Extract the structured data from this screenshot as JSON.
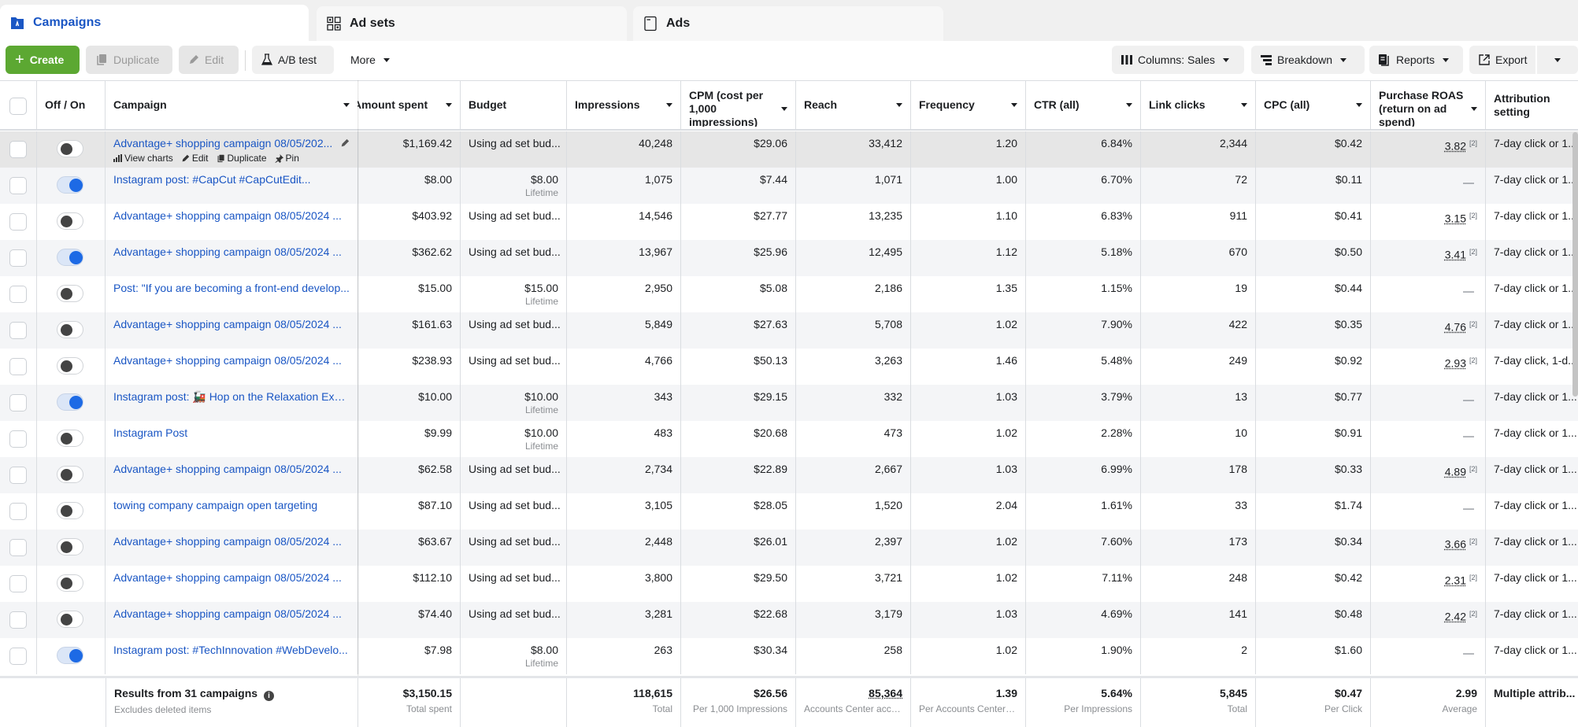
{
  "tabs": [
    {
      "label": "Campaigns",
      "icon": "campaigns-icon",
      "active": true
    },
    {
      "label": "Ad sets",
      "icon": "ad-sets-grid-icon",
      "active": false
    },
    {
      "label": "Ads",
      "icon": "ads-page-icon",
      "active": false
    }
  ],
  "toolbar": {
    "create_label": "Create",
    "duplicate_label": "Duplicate",
    "edit_label": "Edit",
    "ab_test_label": "A/B test",
    "more_label": "More",
    "columns_label": "Columns: Sales",
    "breakdown_label": "Breakdown",
    "reports_label": "Reports",
    "export_label": "Export"
  },
  "columns": {
    "off_on": "Off / On",
    "campaign": "Campaign",
    "amount_spent": "Amount spent",
    "budget": "Budget",
    "impressions": "Impressions",
    "cpm": "CPM (cost per 1,000 impressions)",
    "reach": "Reach",
    "frequency": "Frequency",
    "ctr": "CTR (all)",
    "link_clicks": "Link clicks",
    "cpc": "CPC (all)",
    "roas": "Purchase ROAS (return on ad spend)",
    "attribution": "Attribution setting"
  },
  "row_actions": {
    "view_charts": "View charts",
    "edit": "Edit",
    "duplicate": "Duplicate",
    "pin": "Pin"
  },
  "rows": [
    {
      "on": false,
      "campaign": "Advantage+ shopping campaign 08/05/202...",
      "amount_spent": "$1,169.42",
      "budget": "Using ad set bud...",
      "budget_sub": "",
      "impressions": "40,248",
      "cpm": "$29.06",
      "reach": "33,412",
      "frequency": "1.20",
      "ctr": "6.84%",
      "link_clicks": "2,344",
      "cpc": "$0.42",
      "roas": "3.82",
      "roas_note": "[2]",
      "attribution": "7-day click or 1..."
    },
    {
      "on": true,
      "campaign": "Instagram post: #CapCut #CapCutEdit...",
      "amount_spent": "$8.00",
      "budget": "$8.00",
      "budget_sub": "Lifetime",
      "impressions": "1,075",
      "cpm": "$7.44",
      "reach": "1,071",
      "frequency": "1.00",
      "ctr": "6.70%",
      "link_clicks": "72",
      "cpc": "$0.11",
      "roas": "—",
      "roas_note": "",
      "attribution": "7-day click or 1..."
    },
    {
      "on": false,
      "campaign": "Advantage+ shopping campaign 08/05/2024 ...",
      "amount_spent": "$403.92",
      "budget": "Using ad set bud...",
      "budget_sub": "",
      "impressions": "14,546",
      "cpm": "$27.77",
      "reach": "13,235",
      "frequency": "1.10",
      "ctr": "6.83%",
      "link_clicks": "911",
      "cpc": "$0.41",
      "roas": "3.15",
      "roas_note": "[2]",
      "attribution": "7-day click or 1..."
    },
    {
      "on": true,
      "campaign": "Advantage+ shopping campaign 08/05/2024 ...",
      "amount_spent": "$362.62",
      "budget": "Using ad set bud...",
      "budget_sub": "",
      "impressions": "13,967",
      "cpm": "$25.96",
      "reach": "12,495",
      "frequency": "1.12",
      "ctr": "5.18%",
      "link_clicks": "670",
      "cpc": "$0.50",
      "roas": "3.41",
      "roas_note": "[2]",
      "attribution": "7-day click or 1..."
    },
    {
      "on": false,
      "campaign": "Post: \"If you are becoming a front-end develop...",
      "amount_spent": "$15.00",
      "budget": "$15.00",
      "budget_sub": "Lifetime",
      "impressions": "2,950",
      "cpm": "$5.08",
      "reach": "2,186",
      "frequency": "1.35",
      "ctr": "1.15%",
      "link_clicks": "19",
      "cpc": "$0.44",
      "roas": "—",
      "roas_note": "",
      "attribution": "7-day click or 1..."
    },
    {
      "on": false,
      "campaign": "Advantage+ shopping campaign 08/05/2024 ...",
      "amount_spent": "$161.63",
      "budget": "Using ad set bud...",
      "budget_sub": "",
      "impressions": "5,849",
      "cpm": "$27.63",
      "reach": "5,708",
      "frequency": "1.02",
      "ctr": "7.90%",
      "link_clicks": "422",
      "cpc": "$0.35",
      "roas": "4.76",
      "roas_note": "[2]",
      "attribution": "7-day click or 1..."
    },
    {
      "on": false,
      "campaign": "Advantage+ shopping campaign 08/05/2024 ...",
      "amount_spent": "$238.93",
      "budget": "Using ad set bud...",
      "budget_sub": "",
      "impressions": "4,766",
      "cpm": "$50.13",
      "reach": "3,263",
      "frequency": "1.46",
      "ctr": "5.48%",
      "link_clicks": "249",
      "cpc": "$0.92",
      "roas": "2.93",
      "roas_note": "[2]",
      "attribution": "7-day click, 1-d..."
    },
    {
      "on": true,
      "campaign": "Instagram post: 🚂 Hop on the Relaxation Expr...",
      "amount_spent": "$10.00",
      "budget": "$10.00",
      "budget_sub": "Lifetime",
      "impressions": "343",
      "cpm": "$29.15",
      "reach": "332",
      "frequency": "1.03",
      "ctr": "3.79%",
      "link_clicks": "13",
      "cpc": "$0.77",
      "roas": "—",
      "roas_note": "",
      "attribution": "7-day click or 1..."
    },
    {
      "on": false,
      "campaign": "Instagram Post",
      "amount_spent": "$9.99",
      "budget": "$10.00",
      "budget_sub": "Lifetime",
      "impressions": "483",
      "cpm": "$20.68",
      "reach": "473",
      "frequency": "1.02",
      "ctr": "2.28%",
      "link_clicks": "10",
      "cpc": "$0.91",
      "roas": "—",
      "roas_note": "",
      "attribution": "7-day click or 1..."
    },
    {
      "on": false,
      "campaign": "Advantage+ shopping campaign 08/05/2024 ...",
      "amount_spent": "$62.58",
      "budget": "Using ad set bud...",
      "budget_sub": "",
      "impressions": "2,734",
      "cpm": "$22.89",
      "reach": "2,667",
      "frequency": "1.03",
      "ctr": "6.99%",
      "link_clicks": "178",
      "cpc": "$0.33",
      "roas": "4.89",
      "roas_note": "[2]",
      "attribution": "7-day click or 1..."
    },
    {
      "on": false,
      "campaign": "towing company campaign open targeting",
      "amount_spent": "$87.10",
      "budget": "Using ad set bud...",
      "budget_sub": "",
      "impressions": "3,105",
      "cpm": "$28.05",
      "reach": "1,520",
      "frequency": "2.04",
      "ctr": "1.61%",
      "link_clicks": "33",
      "cpc": "$1.74",
      "roas": "—",
      "roas_note": "",
      "attribution": "7-day click or 1..."
    },
    {
      "on": false,
      "campaign": "Advantage+ shopping campaign 08/05/2024 ...",
      "amount_spent": "$63.67",
      "budget": "Using ad set bud...",
      "budget_sub": "",
      "impressions": "2,448",
      "cpm": "$26.01",
      "reach": "2,397",
      "frequency": "1.02",
      "ctr": "7.60%",
      "link_clicks": "173",
      "cpc": "$0.34",
      "roas": "3.66",
      "roas_note": "[2]",
      "attribution": "7-day click or 1..."
    },
    {
      "on": false,
      "campaign": "Advantage+ shopping campaign 08/05/2024 ...",
      "amount_spent": "$112.10",
      "budget": "Using ad set bud...",
      "budget_sub": "",
      "impressions": "3,800",
      "cpm": "$29.50",
      "reach": "3,721",
      "frequency": "1.02",
      "ctr": "7.11%",
      "link_clicks": "248",
      "cpc": "$0.42",
      "roas": "2.31",
      "roas_note": "[2]",
      "attribution": "7-day click or 1..."
    },
    {
      "on": false,
      "campaign": "Advantage+ shopping campaign 08/05/2024 ...",
      "amount_spent": "$74.40",
      "budget": "Using ad set bud...",
      "budget_sub": "",
      "impressions": "3,281",
      "cpm": "$22.68",
      "reach": "3,179",
      "frequency": "1.03",
      "ctr": "4.69%",
      "link_clicks": "141",
      "cpc": "$0.48",
      "roas": "2.42",
      "roas_note": "[2]",
      "attribution": "7-day click or 1..."
    },
    {
      "on": true,
      "campaign": "Instagram post: #TechInnovation #WebDevelo...",
      "amount_spent": "$7.98",
      "budget": "$8.00",
      "budget_sub": "Lifetime",
      "impressions": "263",
      "cpm": "$30.34",
      "reach": "258",
      "frequency": "1.02",
      "ctr": "1.90%",
      "link_clicks": "2",
      "cpc": "$1.60",
      "roas": "—",
      "roas_note": "",
      "attribution": "7-day click or 1..."
    }
  ],
  "footer": {
    "results_label": "Results from 31 campaigns",
    "results_sub": "Excludes deleted items",
    "amount_spent": "$3,150.15",
    "amount_spent_sub": "Total spent",
    "impressions": "118,615",
    "impressions_sub": "Total",
    "cpm": "$26.56",
    "cpm_sub": "Per 1,000 Impressions",
    "reach": "85,364",
    "reach_sub": "Accounts Center acco...",
    "frequency": "1.39",
    "frequency_sub": "Per Accounts Center a...",
    "ctr": "5.64%",
    "ctr_sub": "Per Impressions",
    "link_clicks": "5,845",
    "link_clicks_sub": "Total",
    "cpc": "$0.47",
    "cpc_sub": "Per Click",
    "roas": "2.99",
    "roas_sub": "Average",
    "attribution": "Multiple attrib..."
  },
  "colors": {
    "accent": "#1a56c4",
    "create_green": "#5ca832",
    "toggle_on": "#1d6ae5"
  }
}
